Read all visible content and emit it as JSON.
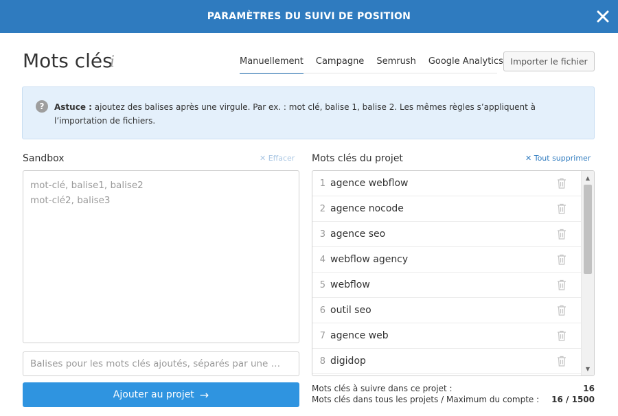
{
  "header": {
    "title": "PARAMÈTRES DU SUIVI DE POSITION",
    "close_icon": "close-icon"
  },
  "page": {
    "title": "Mots clés",
    "info_icon": "i"
  },
  "tabs": [
    {
      "label": "Manuellement",
      "active": true
    },
    {
      "label": "Campagne",
      "active": false
    },
    {
      "label": "Semrush",
      "active": false
    },
    {
      "label": "Google Analytics",
      "active": false
    }
  ],
  "import_button": "Importer le fichier",
  "tip": {
    "icon": "?",
    "label": "Astuce :",
    "text": " ajoutez des balises après une virgule. Par ex. : mot clé, balise 1, balise 2. Les mêmes règles s’appliquent à l’importation de fichiers."
  },
  "sandbox": {
    "label": "Sandbox",
    "clear": "Effacer",
    "placeholder": "mot-clé, balise1, balise2\nmot-clé2, balise3",
    "tags_placeholder": "Balises pour les mots clés ajoutés, séparés par une …",
    "add_button": "Ajouter au projet"
  },
  "keywords": {
    "label": "Mots clés du projet",
    "clear_all": "Tout supprimer",
    "items": [
      {
        "num": "1",
        "kw": "agence webflow"
      },
      {
        "num": "2",
        "kw": "agence nocode"
      },
      {
        "num": "3",
        "kw": "agence seo"
      },
      {
        "num": "4",
        "kw": "webflow agency"
      },
      {
        "num": "5",
        "kw": "webflow"
      },
      {
        "num": "6",
        "kw": "outil seo"
      },
      {
        "num": "7",
        "kw": "agence web"
      },
      {
        "num": "8",
        "kw": "digidop"
      }
    ]
  },
  "stats": {
    "project_label": "Mots clés à suivre dans ce projet :",
    "project_value": "16",
    "all_label": "Mots clés dans tous les projets / Maximum du compte :",
    "all_value": "16 / 1500"
  },
  "colors": {
    "header": "#2f7bbf",
    "primary_button": "#2f94e0",
    "tip_bg": "#e4f0fb"
  }
}
